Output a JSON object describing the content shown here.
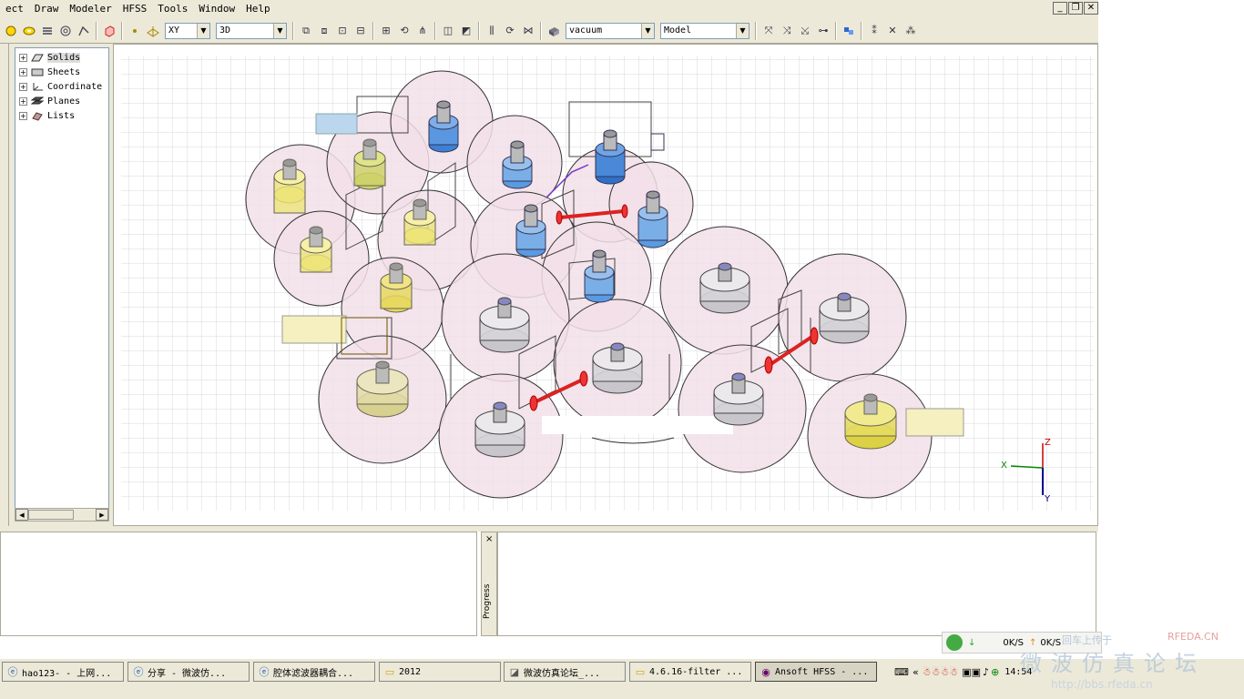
{
  "menubar": {
    "items": [
      "ect",
      "Draw",
      "Modeler",
      "HFSS",
      "Tools",
      "Window",
      "Help"
    ],
    "window_controls": {
      "minimize": "_",
      "restore": "❐",
      "close": "✕"
    }
  },
  "toolbar": {
    "plane_combo": "XY",
    "view_combo": "3D",
    "material_combo": "vacuum",
    "model_combo": "Model"
  },
  "tree": {
    "items": [
      {
        "label": "Solids",
        "icon": "solids-icon"
      },
      {
        "label": "Sheets",
        "icon": "sheets-icon"
      },
      {
        "label": "Coordinate",
        "icon": "coordinate-icon"
      },
      {
        "label": "Planes",
        "icon": "planes-icon"
      },
      {
        "label": "Lists",
        "icon": "lists-icon"
      }
    ],
    "expander": "+"
  },
  "axis_triad": {
    "x": "X",
    "y": "Y",
    "z": "Z"
  },
  "progress_panel": {
    "tab_label": "Progress",
    "close": "×"
  },
  "netmon": {
    "down": "0K/S",
    "up": "0K/S"
  },
  "taskbar": {
    "tasks": [
      {
        "label": "hao123- - 上网...",
        "icon": "ie-icon"
      },
      {
        "label": "分享 - 微波仿...",
        "icon": "ie-icon"
      },
      {
        "label": "腔体滤波器耦合...",
        "icon": "ie-icon"
      },
      {
        "label": "2012",
        "icon": "folder-icon"
      },
      {
        "label": "微波仿真论坛_...",
        "icon": "app-icon"
      },
      {
        "label": "4.6.16-filter ...",
        "icon": "folder-icon"
      },
      {
        "label": "Ansoft HFSS - ...",
        "icon": "hfss-icon"
      }
    ],
    "clock": "14:54",
    "tray_expand": "«"
  },
  "watermark": {
    "brand": "RFEDA.CN",
    "title": "微波仿真论坛",
    "url": "http://bbs.rfeda.cn",
    "caption": "回车上传于"
  }
}
